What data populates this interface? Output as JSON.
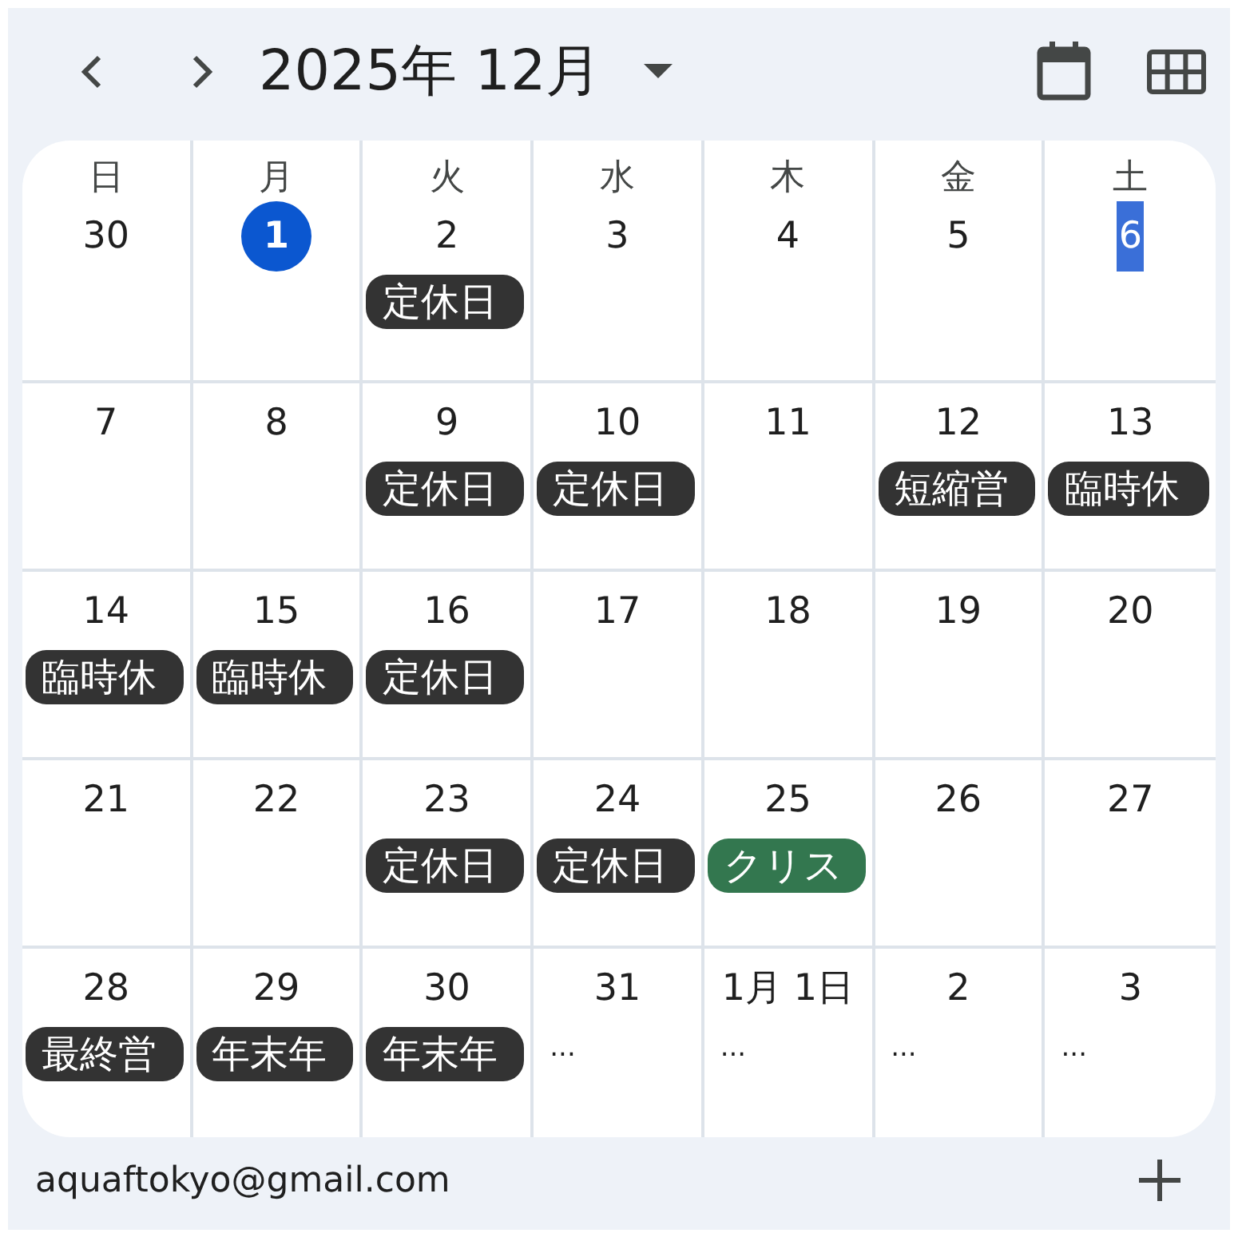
{
  "header": {
    "title": "2025年 12月"
  },
  "weekdays": [
    "日",
    "月",
    "火",
    "水",
    "木",
    "金",
    "土"
  ],
  "weeks": [
    {
      "days": [
        {
          "date": "30",
          "today": false,
          "highlighted": false
        },
        {
          "date": "1",
          "today": true,
          "highlighted": false
        },
        {
          "date": "2",
          "today": false,
          "highlighted": false,
          "events": [
            {
              "title": "定休日",
              "color": "#333333"
            }
          ]
        },
        {
          "date": "3",
          "today": false,
          "highlighted": false
        },
        {
          "date": "4",
          "today": false,
          "highlighted": false
        },
        {
          "date": "5",
          "today": false,
          "highlighted": false
        },
        {
          "date": "6",
          "today": false,
          "highlighted": true
        }
      ]
    },
    {
      "days": [
        {
          "date": "7",
          "today": false,
          "highlighted": false
        },
        {
          "date": "8",
          "today": false,
          "highlighted": false
        },
        {
          "date": "9",
          "today": false,
          "highlighted": false,
          "events": [
            {
              "title": "定休日",
              "color": "#333333"
            }
          ]
        },
        {
          "date": "10",
          "today": false,
          "highlighted": false,
          "events": [
            {
              "title": "定休日",
              "color": "#333333"
            }
          ]
        },
        {
          "date": "11",
          "today": false,
          "highlighted": false
        },
        {
          "date": "12",
          "today": false,
          "highlighted": false,
          "events": [
            {
              "title": "短縮営",
              "color": "#333333"
            }
          ]
        },
        {
          "date": "13",
          "today": false,
          "highlighted": false,
          "events": [
            {
              "title": "臨時休",
              "color": "#333333"
            }
          ]
        }
      ]
    },
    {
      "days": [
        {
          "date": "14",
          "today": false,
          "highlighted": false,
          "events": [
            {
              "title": "臨時休",
              "color": "#333333"
            }
          ]
        },
        {
          "date": "15",
          "today": false,
          "highlighted": false,
          "events": [
            {
              "title": "臨時休",
              "color": "#333333"
            }
          ]
        },
        {
          "date": "16",
          "today": false,
          "highlighted": false,
          "events": [
            {
              "title": "定休日",
              "color": "#333333"
            }
          ]
        },
        {
          "date": "17",
          "today": false,
          "highlighted": false
        },
        {
          "date": "18",
          "today": false,
          "highlighted": false
        },
        {
          "date": "19",
          "today": false,
          "highlighted": false
        },
        {
          "date": "20",
          "today": false,
          "highlighted": false
        }
      ]
    },
    {
      "days": [
        {
          "date": "21",
          "today": false,
          "highlighted": false
        },
        {
          "date": "22",
          "today": false,
          "highlighted": false
        },
        {
          "date": "23",
          "today": false,
          "highlighted": false,
          "events": [
            {
              "title": "定休日",
              "color": "#333333"
            }
          ]
        },
        {
          "date": "24",
          "today": false,
          "highlighted": false,
          "events": [
            {
              "title": "定休日",
              "color": "#333333"
            }
          ]
        },
        {
          "date": "25",
          "today": false,
          "highlighted": false,
          "events": [
            {
              "title": "クリス",
              "color": "#33774f"
            }
          ]
        },
        {
          "date": "26",
          "today": false,
          "highlighted": false
        },
        {
          "date": "27",
          "today": false,
          "highlighted": false
        }
      ]
    },
    {
      "days": [
        {
          "date": "28",
          "today": false,
          "highlighted": false,
          "events": [
            {
              "title": "最終営",
              "color": "#333333"
            }
          ]
        },
        {
          "date": "29",
          "today": false,
          "highlighted": false,
          "events": [
            {
              "title": "年末年",
              "color": "#333333"
            }
          ]
        },
        {
          "date": "30",
          "today": false,
          "highlighted": false,
          "events": [
            {
              "title": "年末年",
              "color": "#333333"
            }
          ]
        },
        {
          "date": "31",
          "today": false,
          "highlighted": false,
          "more": "..."
        },
        {
          "date": "1月 1日",
          "today": false,
          "highlighted": false,
          "more": "..."
        },
        {
          "date": "2",
          "today": false,
          "highlighted": false,
          "more": "..."
        },
        {
          "date": "3",
          "today": false,
          "highlighted": false,
          "more": "..."
        }
      ]
    }
  ],
  "footer": {
    "account": "aquaftokyo@gmail.com"
  }
}
